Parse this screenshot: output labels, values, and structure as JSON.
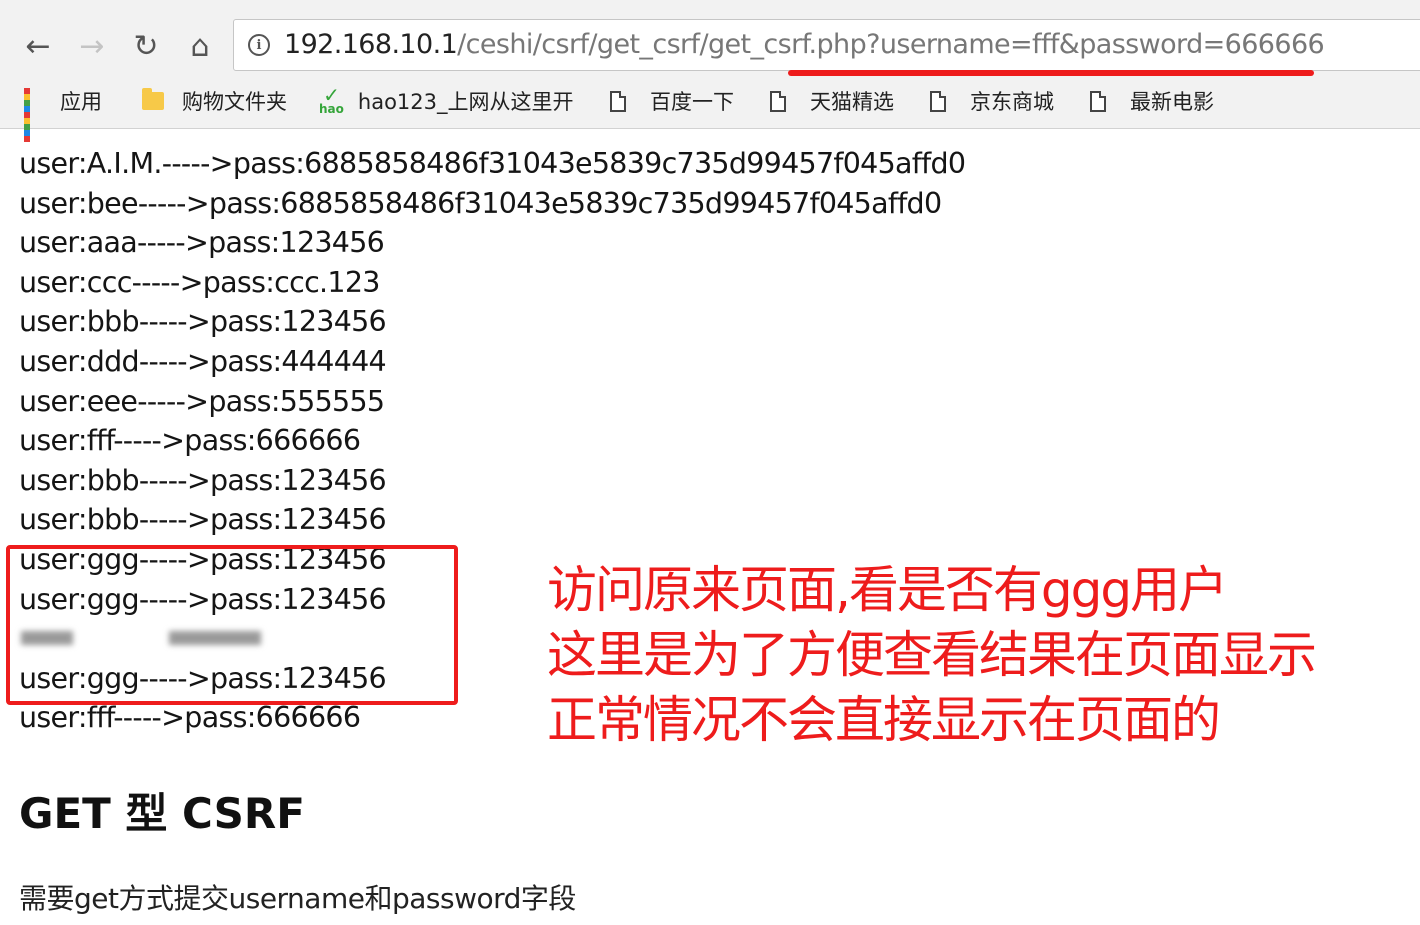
{
  "browser": {
    "address_bar": {
      "host": "192.168.10.1",
      "path": "/ceshi/csrf/get_csrf/get_csrf.php?username=fff&password=666666"
    },
    "bookmarks": [
      {
        "label": "应用",
        "icon": "apps-grid-icon"
      },
      {
        "label": "购物文件夹",
        "icon": "folder-icon"
      },
      {
        "label": "hao123_上网从这里开",
        "icon": "hao123-icon"
      },
      {
        "label": "百度一下",
        "icon": "page-icon"
      },
      {
        "label": "天猫精选",
        "icon": "page-icon"
      },
      {
        "label": "京东商城",
        "icon": "page-icon"
      },
      {
        "label": "最新电影",
        "icon": "page-icon"
      }
    ]
  },
  "page": {
    "records": [
      "user:A.I.M.----->pass:6885858486f31043e5839c735d99457f045affd0",
      "user:bee----->pass:6885858486f31043e5839c735d99457f045affd0",
      "user:aaa----->pass:123456",
      "user:ccc----->pass:ccc.123",
      "user:bbb----->pass:123456",
      "user:ddd----->pass:444444",
      "user:eee----->pass:555555",
      "user:fff----->pass:666666",
      "user:bbb----->pass:123456",
      "user:bbb----->pass:123456",
      "user:ggg----->pass:123456",
      "user:ggg----->pass:123456"
    ],
    "records_after": [
      "user:ggg----->pass:123456",
      "user:fff----->pass:666666"
    ],
    "heading": "GET 型 CSRF",
    "description": "需要get方式提交username和password字段"
  },
  "annotation": {
    "lines": [
      "访问原来页面,看是否有ggg用户",
      "这里是为了方便查看结果在页面显示",
      "正常情况不会直接显示在页面的"
    ],
    "color": "#ee1c1c"
  }
}
